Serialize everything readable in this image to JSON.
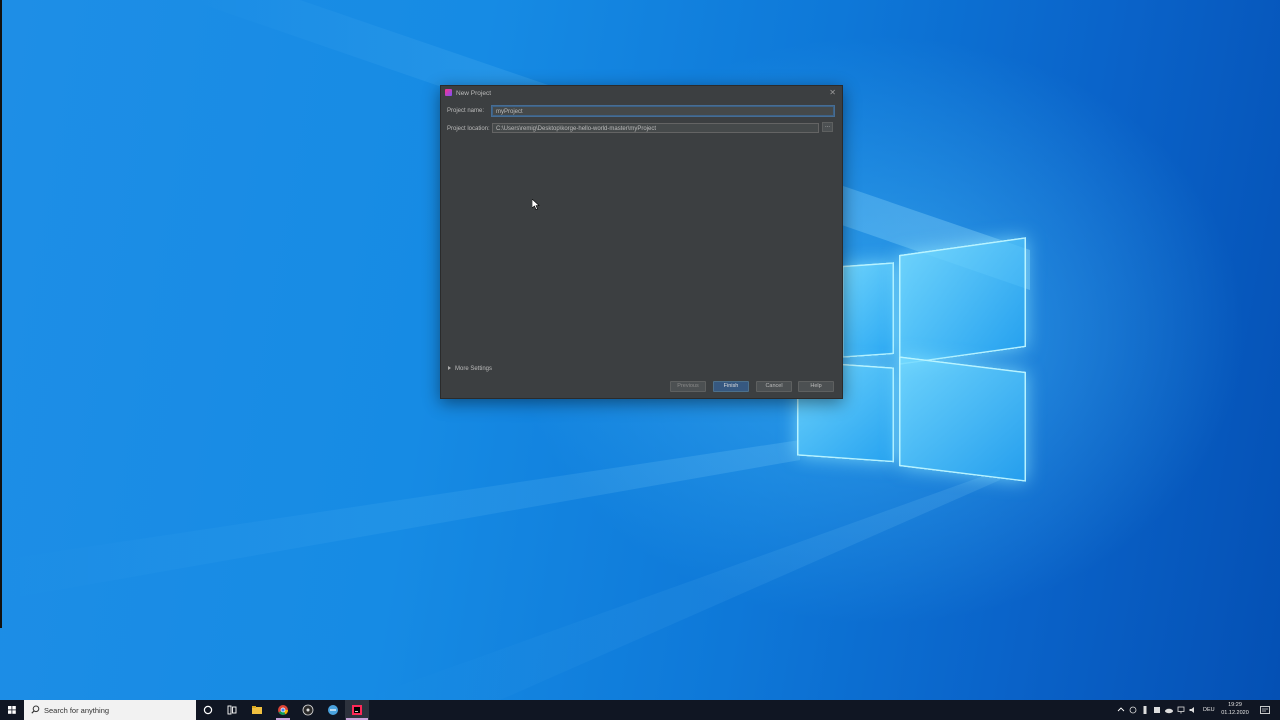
{
  "dialog": {
    "title": "New Project",
    "project_name_label": "Project name:",
    "project_name_value": "myProject",
    "project_location_label": "Project location:",
    "project_location_value": "C:\\Users\\remig\\Desktop\\korge-hello-world-master\\myProject",
    "browse_label": "...",
    "more_settings_label": "More Settings",
    "buttons": {
      "previous": "Previous",
      "finish": "Finish",
      "cancel": "Cancel",
      "help": "Help"
    }
  },
  "taskbar": {
    "search_placeholder": "Search for anything",
    "language": "DEU",
    "time": "19:29",
    "date": "01.12.2020",
    "apps": [
      "task-view",
      "file-explorer",
      "chrome",
      "obs",
      "app-blue",
      "intellij"
    ]
  },
  "colors": {
    "dialog_bg": "#3c3f41",
    "primary_button": "#365880",
    "desktop_blue": "#0e78d8",
    "taskbar_bg": "#101623"
  }
}
